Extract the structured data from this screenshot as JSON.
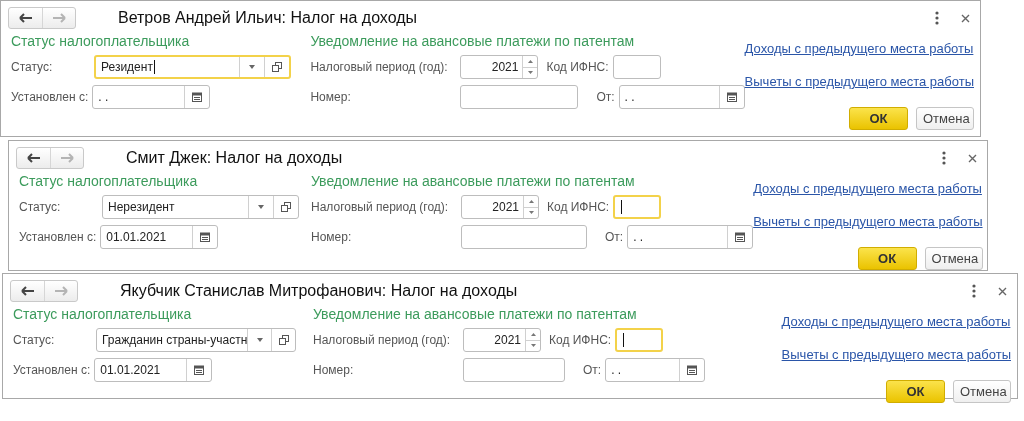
{
  "windows": [
    {
      "title": "Ветров Андрей Ильич: Налог на доходы",
      "forward_disabled": true,
      "status_section": "Статус налогоплательщика",
      "status_label": "Статус:",
      "status_value": "Резидент",
      "status_focused": true,
      "established_label": "Установлен с:",
      "established_value": ". .",
      "notice_section": "Уведомление на авансовые платежи по патентам",
      "period_label": "Налоговый период (год):",
      "period_value": "2021",
      "ifns_label": "Код ИФНС:",
      "ifns_focused": false,
      "number_label": "Номер:",
      "from_label": "От:",
      "from_value": ". .",
      "links": [
        "Доходы с предыдущего места работы",
        "Вычеты с предыдущего места работы"
      ],
      "ok": "ОК",
      "cancel": "Отмена"
    },
    {
      "title": "Смит Джек: Налог на доходы",
      "forward_disabled": true,
      "status_section": "Статус налогоплательщика",
      "status_label": "Статус:",
      "status_value": "Нерезидент",
      "status_focused": false,
      "established_label": "Установлен с:",
      "established_value": "01.01.2021",
      "notice_section": "Уведомление на авансовые платежи по патентам",
      "period_label": "Налоговый период (год):",
      "period_value": "2021",
      "ifns_label": "Код ИФНС:",
      "ifns_focused": true,
      "number_label": "Номер:",
      "from_label": "От:",
      "from_value": ". .",
      "links": [
        "Доходы с предыдущего места работы",
        "Вычеты с предыдущего места работы"
      ],
      "ok": "ОК",
      "cancel": "Отмена"
    },
    {
      "title": "Якубчик Станислав Митрофанович: Налог на доходы",
      "forward_disabled": true,
      "status_section": "Статус налогоплательщика",
      "status_label": "Статус:",
      "status_value": "Гражданин страны-участн",
      "status_focused": false,
      "established_label": "Установлен с:",
      "established_value": "01.01.2021",
      "notice_section": "Уведомление на авансовые платежи по патентам",
      "period_label": "Налоговый период (год):",
      "period_value": "2021",
      "ifns_label": "Код ИФНС:",
      "ifns_focused": true,
      "number_label": "Номер:",
      "from_label": "От:",
      "from_value": ". .",
      "links": [
        "Доходы с предыдущего места работы",
        "Вычеты с предыдущего места работы"
      ],
      "ok": "ОК",
      "cancel": "Отмена"
    }
  ]
}
